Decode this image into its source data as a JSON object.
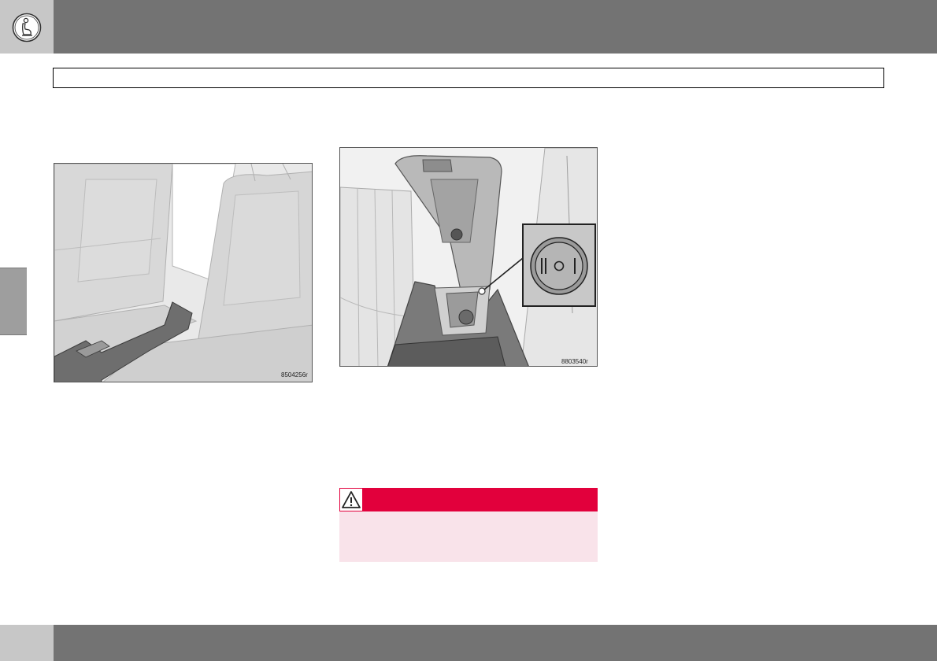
{
  "header": {
    "icon": "seat-person-icon",
    "bar_color": "#737373",
    "tab_color": "#c7c7c7"
  },
  "section_title": "",
  "figures": [
    {
      "code": "8504256r",
      "depicts": "rear seat armrest"
    },
    {
      "code": "8803540r",
      "depicts": "tunnel console with switch"
    }
  ],
  "warning": {
    "icon": "warning-triangle-icon",
    "color": "#e2003c",
    "background": "#f9e3ea"
  },
  "footer": {
    "bar_color": "#737373",
    "tab_color": "#c7c7c7"
  }
}
